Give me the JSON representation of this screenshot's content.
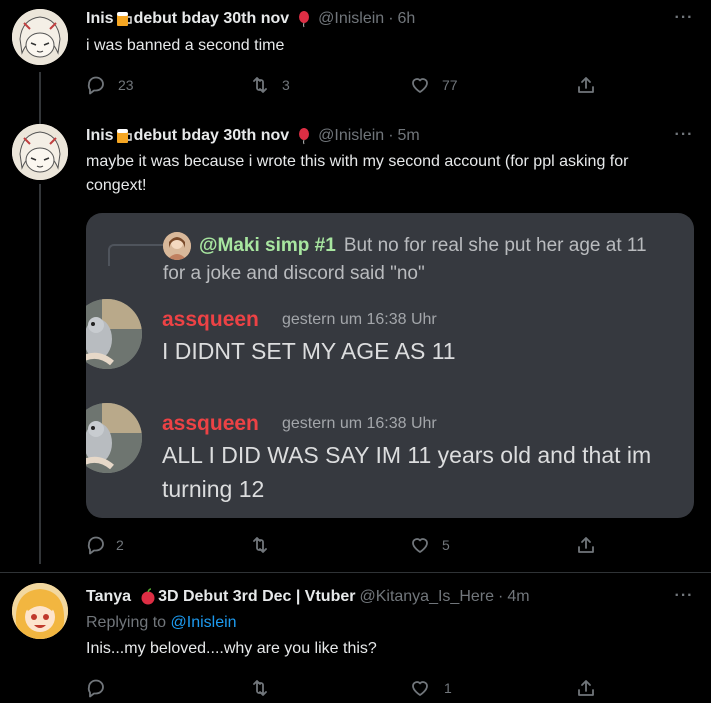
{
  "tweets": [
    {
      "name": "Inis",
      "name_suffix": "debut bday 30th nov",
      "handle": "@Inislein",
      "time": "6h",
      "text": "i was banned a second time",
      "replies": "23",
      "retweets": "3",
      "likes": "77"
    },
    {
      "name": "Inis",
      "name_suffix": "debut bday 30th nov",
      "handle": "@Inislein",
      "time": "5m",
      "text": "maybe it was because i wrote this with my second account (for ppl asking for congext!",
      "replies": "2",
      "retweets": "",
      "likes": "5",
      "embed": {
        "reply_name": "@Maki simp #1",
        "reply_text_line1": "But no for real she put her age at 11",
        "reply_text_line2": "for a joke and discord said \"no\"",
        "messages": [
          {
            "author": "assqueen",
            "timestamp": "gestern um 16:38 Uhr",
            "text": "I DIDNT SET MY AGE AS 11"
          },
          {
            "author": "assqueen",
            "timestamp": "gestern um 16:38 Uhr",
            "text": "ALL I DID WAS SAY IM 11 years old and that im turning 12"
          }
        ]
      }
    },
    {
      "name": "Tanya",
      "name_suffix": "3D Debut 3rd Dec | Vtuber",
      "handle": "@Kitanya_Is_Here",
      "time": "4m",
      "replying_label": "Replying to",
      "replying_to": "@Inislein",
      "text": "Inis...my beloved....why are you like this?",
      "replies": "",
      "retweets": "",
      "likes": "1"
    }
  ],
  "colors": {
    "background": "#000000",
    "text": "#e7e9ea",
    "muted": "#71767b",
    "link": "#1d9bf0",
    "discord_bg": "#36393f",
    "discord_name": "#ed4245",
    "discord_reply_name": "#a8e6a0"
  },
  "icons": [
    "reply-icon",
    "retweet-icon",
    "like-icon",
    "share-icon",
    "more-icon",
    "beer-icon",
    "balloon-icon",
    "apple-icon"
  ]
}
